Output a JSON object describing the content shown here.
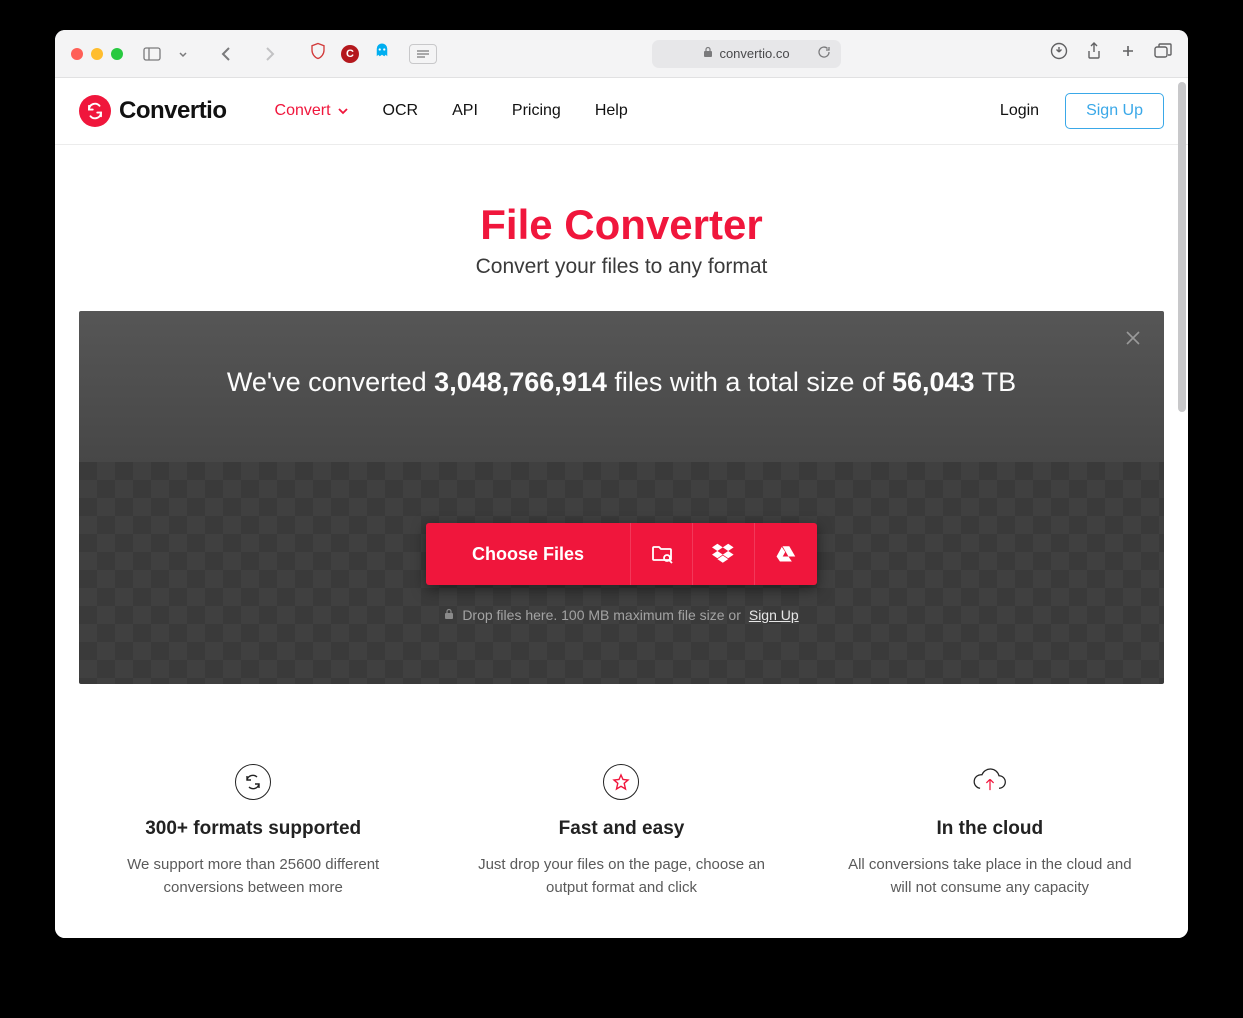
{
  "browser": {
    "url_host": "convertio.co"
  },
  "header": {
    "brand": "Convertio",
    "nav": {
      "convert": "Convert",
      "ocr": "OCR",
      "api": "API",
      "pricing": "Pricing",
      "help": "Help"
    },
    "login": "Login",
    "signup": "Sign Up"
  },
  "hero": {
    "title": "File Converter",
    "subtitle": "Convert your files to any format"
  },
  "stats": {
    "prefix": "We've converted ",
    "files": "3,048,766,914",
    "middle": " files with a total size of ",
    "size": "56,043",
    "unit": " TB"
  },
  "upload": {
    "choose": "Choose Files",
    "hint_prefix": "Drop files here. 100 MB maximum file size or ",
    "hint_link": "Sign Up"
  },
  "features": [
    {
      "title": "300+ formats supported",
      "body": "We support more than 25600 different conversions between more"
    },
    {
      "title": "Fast and easy",
      "body": "Just drop your files on the page, choose an output format and click"
    },
    {
      "title": "In the cloud",
      "body": "All conversions take place in the cloud and will not consume any capacity"
    }
  ]
}
